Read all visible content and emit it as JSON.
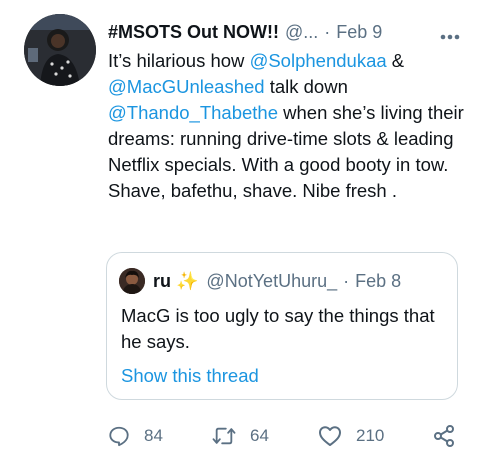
{
  "tweet": {
    "author_name": "#MSOTS Out NOW!!",
    "author_handle": "@...",
    "separator": "·",
    "time": "Feb 9",
    "text_parts": [
      "It’s hilarious how ",
      "@Solphendukaa",
      " & ",
      "@MacGUnleashed",
      " talk down ",
      "@Thando_Thabethe",
      " when she’s living their dreams: running drive-time slots & leading Netflix specials. With a good booty in tow. Shave, bafethu, shave. Nibe fresh ."
    ]
  },
  "quote": {
    "name": "ru",
    "sparkle": "✨",
    "handle": "@NotYetUhuru_",
    "separator": "·",
    "time": "Feb 8",
    "text": "MacG is too ugly to say the things that he says.",
    "thread_link": "Show this thread"
  },
  "actions": {
    "reply_count": "84",
    "retweet_count": "64",
    "like_count": "210"
  },
  "colors": {
    "link": "#1b95e0",
    "muted": "#5b7083",
    "border": "#cfd9de"
  }
}
